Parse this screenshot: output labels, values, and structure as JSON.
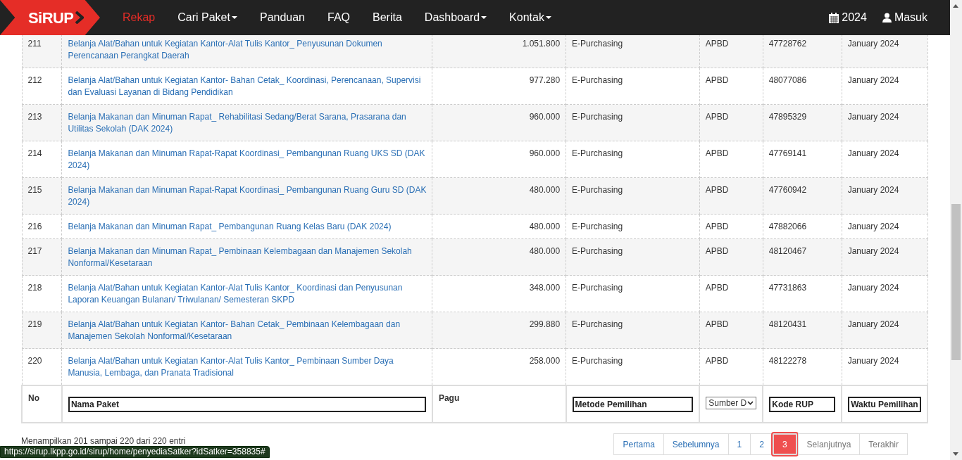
{
  "navbar": {
    "logo": "SiRUP",
    "items": [
      {
        "label": "Rekap",
        "selected": true,
        "dropdown": false
      },
      {
        "label": "Cari Paket",
        "selected": false,
        "dropdown": true
      },
      {
        "label": "Panduan",
        "selected": false,
        "dropdown": false
      },
      {
        "label": "FAQ",
        "selected": false,
        "dropdown": false
      },
      {
        "label": "Berita",
        "selected": false,
        "dropdown": false
      },
      {
        "label": "Dashboard",
        "selected": false,
        "dropdown": true
      },
      {
        "label": "Kontak",
        "selected": false,
        "dropdown": true
      }
    ],
    "year": "2024",
    "login": "Masuk"
  },
  "table": {
    "rows": [
      {
        "no": "211",
        "nama": "Belanja Alat/Bahan untuk Kegiatan Kantor-Alat Tulis Kantor_ Penyusunan Dokumen Perencanaan Perangkat Daerah",
        "pagu": "1.051.800",
        "metode": "E-Purchasing",
        "sumber": "APBD",
        "kode": "47728762",
        "waktu": "January 2024"
      },
      {
        "no": "212",
        "nama": "Belanja Alat/Bahan untuk Kegiatan Kantor- Bahan Cetak_ Koordinasi, Perencanaan, Supervisi dan Evaluasi Layanan di Bidang Pendidikan",
        "pagu": "977.280",
        "metode": "E-Purchasing",
        "sumber": "APBD",
        "kode": "48077086",
        "waktu": "January 2024"
      },
      {
        "no": "213",
        "nama": "Belanja Makanan dan Minuman Rapat_ Rehabilitasi Sedang/Berat Sarana, Prasarana dan Utilitas Sekolah (DAK 2024)",
        "pagu": "960.000",
        "metode": "E-Purchasing",
        "sumber": "APBD",
        "kode": "47895329",
        "waktu": "January 2024"
      },
      {
        "no": "214",
        "nama": "Belanja Makanan dan Minuman Rapat-Rapat Koordinasi_ Pembangunan Ruang UKS SD (DAK 2024)",
        "pagu": "960.000",
        "metode": "E-Purchasing",
        "sumber": "APBD",
        "kode": "47769141",
        "waktu": "January 2024"
      },
      {
        "no": "215",
        "nama": "Belanja Makanan dan Minuman Rapat-Rapat Koordinasi_ Pembangunan Ruang Guru SD (DAK 2024)",
        "pagu": "480.000",
        "metode": "E-Purchasing",
        "sumber": "APBD",
        "kode": "47760942",
        "waktu": "January 2024"
      },
      {
        "no": "216",
        "nama": "Belanja Makanan dan Minuman Rapat_ Pembangunan Ruang Kelas Baru (DAK 2024)",
        "pagu": "480.000",
        "metode": "E-Purchasing",
        "sumber": "APBD",
        "kode": "47882066",
        "waktu": "January 2024"
      },
      {
        "no": "217",
        "nama": "Belanja Makanan dan Minuman Rapat_ Pembinaan Kelembagaan dan Manajemen Sekolah Nonformal/Kesetaraan",
        "pagu": "480.000",
        "metode": "E-Purchasing",
        "sumber": "APBD",
        "kode": "48120467",
        "waktu": "January 2024"
      },
      {
        "no": "218",
        "nama": "Belanja Alat/Bahan untuk Kegiatan Kantor-Alat Tulis Kantor_ Koordinasi dan Penyusunan Laporan Keuangan Bulanan/ Triwulanan/ Semesteran SKPD",
        "pagu": "348.000",
        "metode": "E-Purchasing",
        "sumber": "APBD",
        "kode": "47731863",
        "waktu": "January 2024"
      },
      {
        "no": "219",
        "nama": "Belanja Alat/Bahan untuk Kegiatan Kantor- Bahan Cetak_ Pembinaan Kelembagaan dan Manajemen Sekolah Nonformal/Kesetaraan",
        "pagu": "299.880",
        "metode": "E-Purchasing",
        "sumber": "APBD",
        "kode": "48120431",
        "waktu": "January 2024"
      },
      {
        "no": "220",
        "nama": "Belanja Alat/Bahan untuk Kegiatan Kantor-Alat Tulis Kantor_ Pembinaan Sumber Daya Manusia, Lembaga, dan Pranata Tradisional",
        "pagu": "258.000",
        "metode": "E-Purchasing",
        "sumber": "APBD",
        "kode": "48122278",
        "waktu": "January 2024"
      }
    ],
    "footer": {
      "no": "No",
      "nama_placeholder": "Nama Paket",
      "pagu": "Pagu",
      "metode_placeholder": "Metode Pemilihan",
      "sumber_select": "Sumber D",
      "kode_placeholder": "Kode RUP",
      "waktu_placeholder": "Waktu Pemilihan"
    }
  },
  "info": "Menampilkan 201 sampai 220 dari 220 entri",
  "pagination": [
    {
      "label": "Pertama",
      "selected": false,
      "disabled": false
    },
    {
      "label": "Sebelumnya",
      "selected": false,
      "disabled": false
    },
    {
      "label": "1",
      "selected": false,
      "disabled": false
    },
    {
      "label": "2",
      "selected": false,
      "disabled": false
    },
    {
      "label": "3",
      "selected": true,
      "disabled": false
    },
    {
      "label": "Selanjutnya",
      "selected": false,
      "disabled": true
    },
    {
      "label": "Terakhir",
      "selected": false,
      "disabled": true
    }
  ],
  "status_url": "https://sirup.lkpp.go.id/sirup/home/penyediaSatker?idSatker=358835#"
}
